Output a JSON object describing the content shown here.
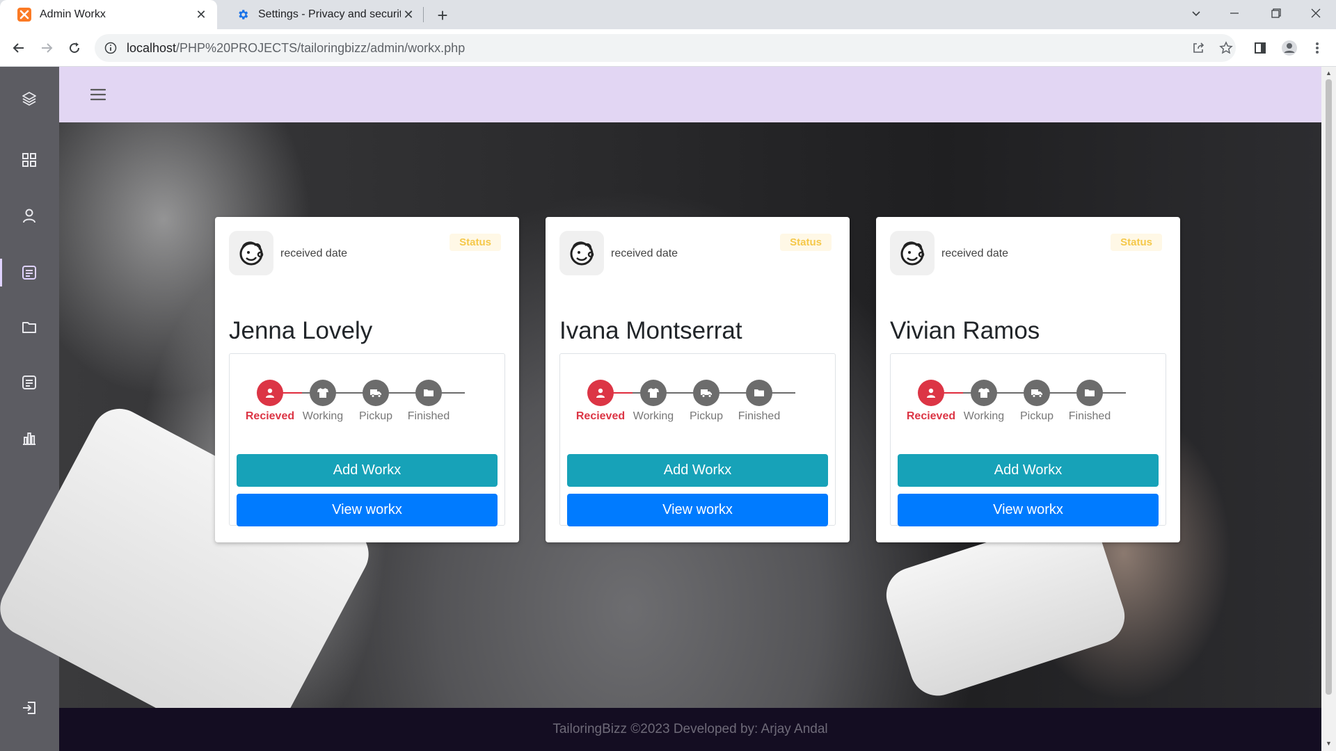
{
  "browser": {
    "tabs": [
      {
        "title": "Admin Workx",
        "active": true
      },
      {
        "title": "Settings - Privacy and security",
        "active": false
      }
    ],
    "url_host": "localhost",
    "url_path": "/PHP%20PROJECTS/tailoringbizz/admin/workx.php"
  },
  "sidebar": {
    "items": [
      {
        "icon": "layers-icon"
      },
      {
        "icon": "dashboard-grid-icon"
      },
      {
        "icon": "user-icon"
      },
      {
        "icon": "orders-icon",
        "active": true
      },
      {
        "icon": "folder-icon"
      },
      {
        "icon": "document-icon"
      },
      {
        "icon": "bar-chart-icon"
      }
    ],
    "logout_icon": "logout-icon"
  },
  "cards": [
    {
      "received_label": "received date",
      "status": "Status",
      "name": "Jenna Lovely",
      "steps": [
        "Recieved",
        "Working",
        "Pickup",
        "Finished"
      ],
      "current_step": 0,
      "add_label": "Add Workx",
      "view_label": "View workx"
    },
    {
      "received_label": "received date",
      "status": "Status",
      "name": "Ivana Montserrat",
      "steps": [
        "Recieved",
        "Working",
        "Pickup",
        "Finished"
      ],
      "current_step": 0,
      "add_label": "Add Workx",
      "view_label": "View workx"
    },
    {
      "received_label": "received date",
      "status": "Status",
      "name": "Vivian Ramos",
      "steps": [
        "Recieved",
        "Working",
        "Pickup",
        "Finished"
      ],
      "current_step": 0,
      "add_label": "Add Workx",
      "view_label": "View workx"
    }
  ],
  "footer": {
    "text": "TailoringBizz ©2023 Developed by: Arjay Andal"
  },
  "colors": {
    "sidebar": "#5c5c62",
    "topbar": "#e2d6f3",
    "received_active": "#dc3545",
    "step_inactive": "#6c6c6c",
    "add_button": "#17a2b8",
    "view_button": "#007bff",
    "status_text": "#f5c84a",
    "footer_bg": "#140d22"
  }
}
